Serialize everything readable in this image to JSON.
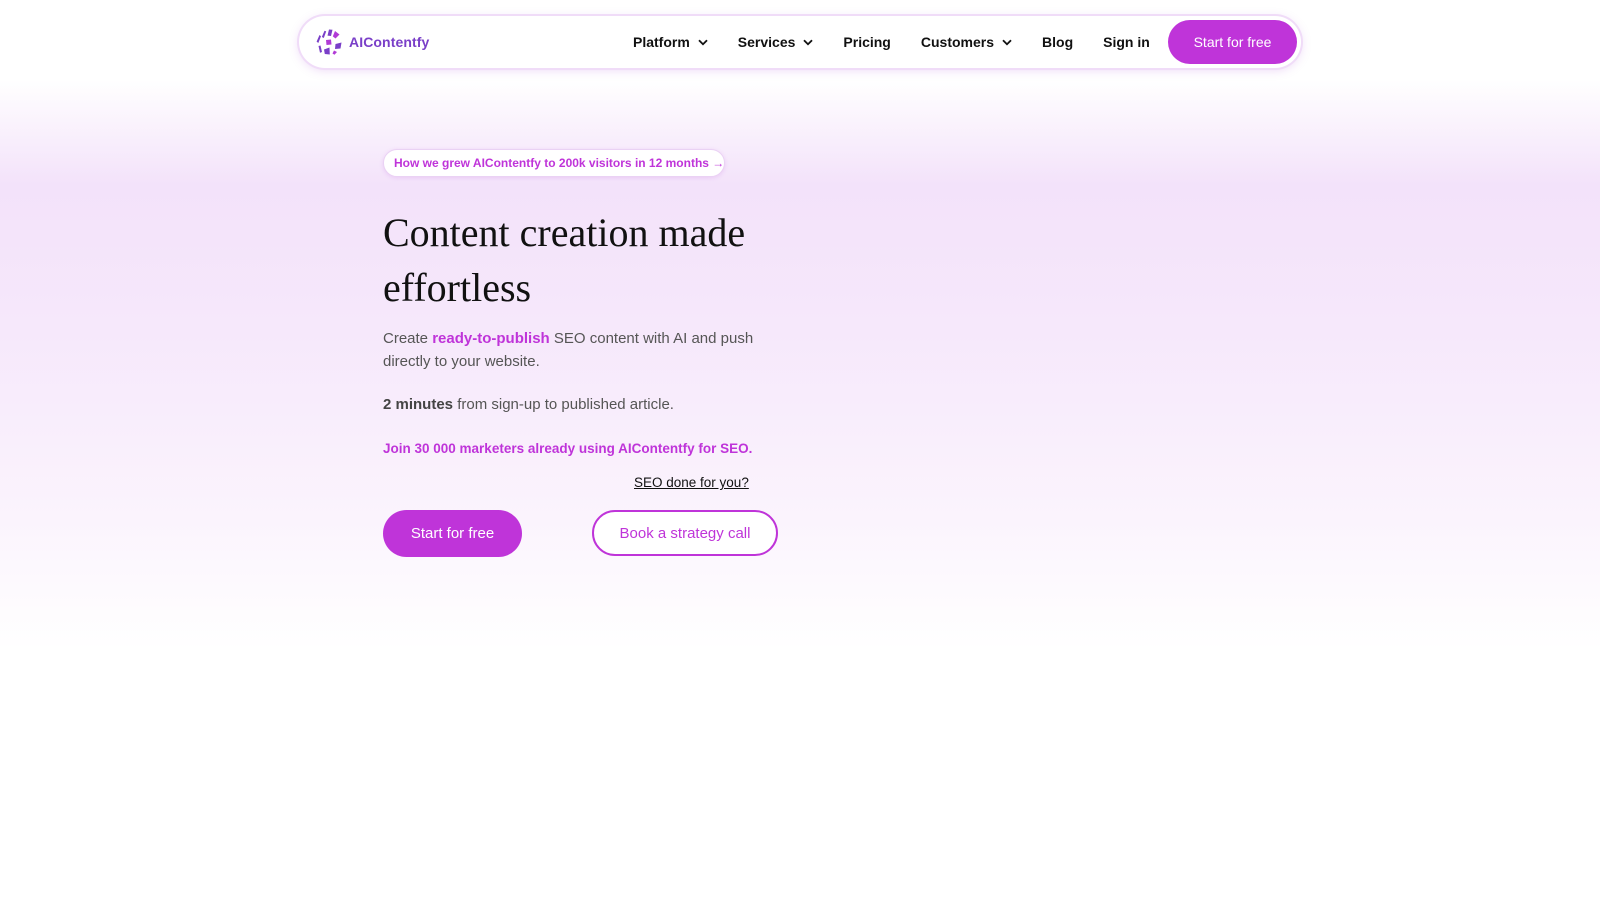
{
  "brand": {
    "name": "AIContentfy",
    "accent_color": "#bf34d9",
    "logo_color": "#7a3fc8",
    "logo_icon": "aicontentfy-logo-icon"
  },
  "nav": {
    "items": [
      {
        "label": "Platform",
        "has_dropdown": true
      },
      {
        "label": "Services",
        "has_dropdown": true
      },
      {
        "label": "Pricing",
        "has_dropdown": false
      },
      {
        "label": "Customers",
        "has_dropdown": true
      },
      {
        "label": "Blog",
        "has_dropdown": false
      },
      {
        "label": "Sign in",
        "has_dropdown": false
      }
    ],
    "cta_label": "Start for free"
  },
  "hero": {
    "announcement": "How we grew AIContentfy to 200k visitors in 12 months →",
    "headline": "Content creation made effortless",
    "subtext_before": "Create ",
    "subtext_highlight": "ready-to-publish",
    "subtext_after": " SEO content with AI and push directly to your website.",
    "timing_bold": "2 minutes",
    "timing_rest": " from sign-up to published article.",
    "join_text": "Join 30 000 marketers already using AIContentfy for SEO.",
    "seo_link": "SEO done for you?",
    "primary_button": "Start for free",
    "secondary_button": "Book a strategy call"
  }
}
